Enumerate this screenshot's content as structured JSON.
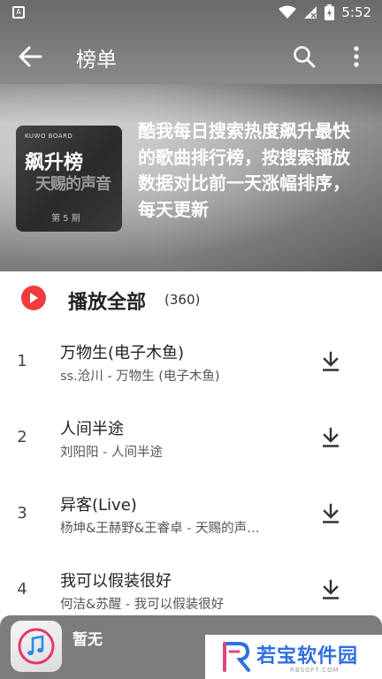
{
  "status_bar": {
    "time": "5:52",
    "app_badge": "A"
  },
  "toolbar": {
    "title": "榜单"
  },
  "chart": {
    "cover_small_text": "KUWO BOARD",
    "cover_title": "飙升榜",
    "cover_art_text": "天赐的声音",
    "cover_issue": "第 5 期",
    "description": "酷我每日搜索热度飙升最快的歌曲排行榜，按搜索播放数据对比前一天涨幅排序，每天更新"
  },
  "play_all": {
    "label": "播放全部",
    "count": "(360)"
  },
  "songs": [
    {
      "index": "1",
      "title": "万物生(电子木鱼)",
      "subtitle": "ss.沧川 - 万物生 (电子木鱼)"
    },
    {
      "index": "2",
      "title": "人间半途",
      "subtitle": "刘阳阳 - 人间半途"
    },
    {
      "index": "3",
      "title": "异客(Live)",
      "subtitle": "杨坤&王赫野&王睿卓 - 天赐的声…"
    },
    {
      "index": "4",
      "title": "我可以假装很好",
      "subtitle": "何洁&苏醒 - 我可以假装很好"
    }
  ],
  "player": {
    "title": "暂无"
  },
  "watermark": {
    "text": "若宝软件园",
    "sub": "RBSOFT.COM"
  },
  "colors": {
    "accent_red": "#ef3b3b",
    "watermark_blue": "#2f6fe0"
  }
}
